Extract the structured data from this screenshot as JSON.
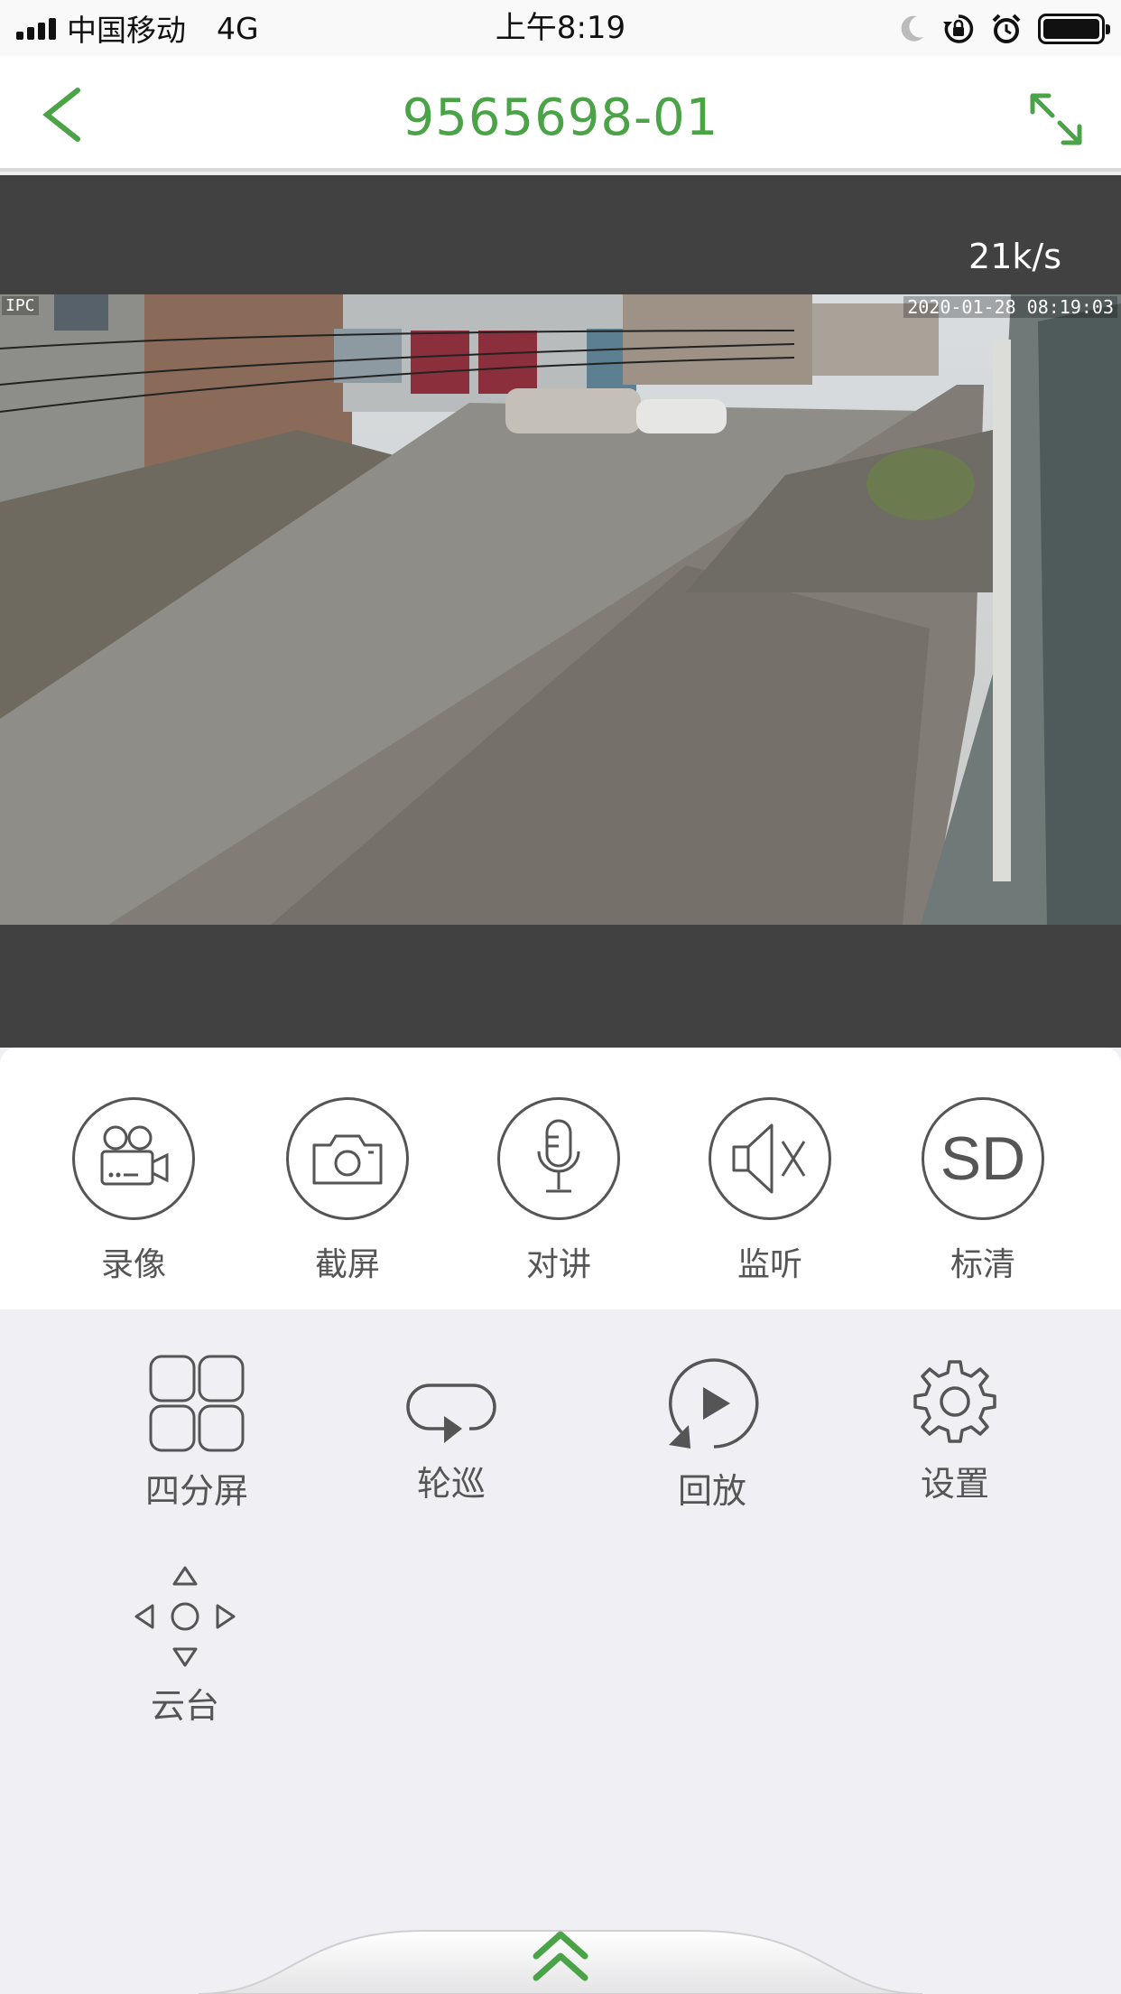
{
  "status_bar": {
    "carrier": "中国移动",
    "network": "4G",
    "time": "上午8:19"
  },
  "nav": {
    "title": "9565698-01",
    "accent_color": "#4aa347"
  },
  "video": {
    "bitrate": "21k/s",
    "osd_channel": "IPC",
    "osd_timestamp": "2020-01-28 08:19:03"
  },
  "controls": [
    {
      "label": "录像",
      "icon": "video-camera-icon"
    },
    {
      "label": "截屏",
      "icon": "camera-icon"
    },
    {
      "label": "对讲",
      "icon": "microphone-icon"
    },
    {
      "label": "监听",
      "icon": "speaker-mute-icon"
    },
    {
      "label": "标清",
      "icon": "sd-quality-icon",
      "icon_text": "SD"
    }
  ],
  "tools": [
    {
      "label": "四分屏",
      "icon": "quad-screen-icon"
    },
    {
      "label": "轮巡",
      "icon": "loop-patrol-icon"
    },
    {
      "label": "回放",
      "icon": "playback-icon"
    },
    {
      "label": "设置",
      "icon": "gear-icon"
    },
    {
      "label": "云台",
      "icon": "ptz-direction-icon"
    }
  ]
}
